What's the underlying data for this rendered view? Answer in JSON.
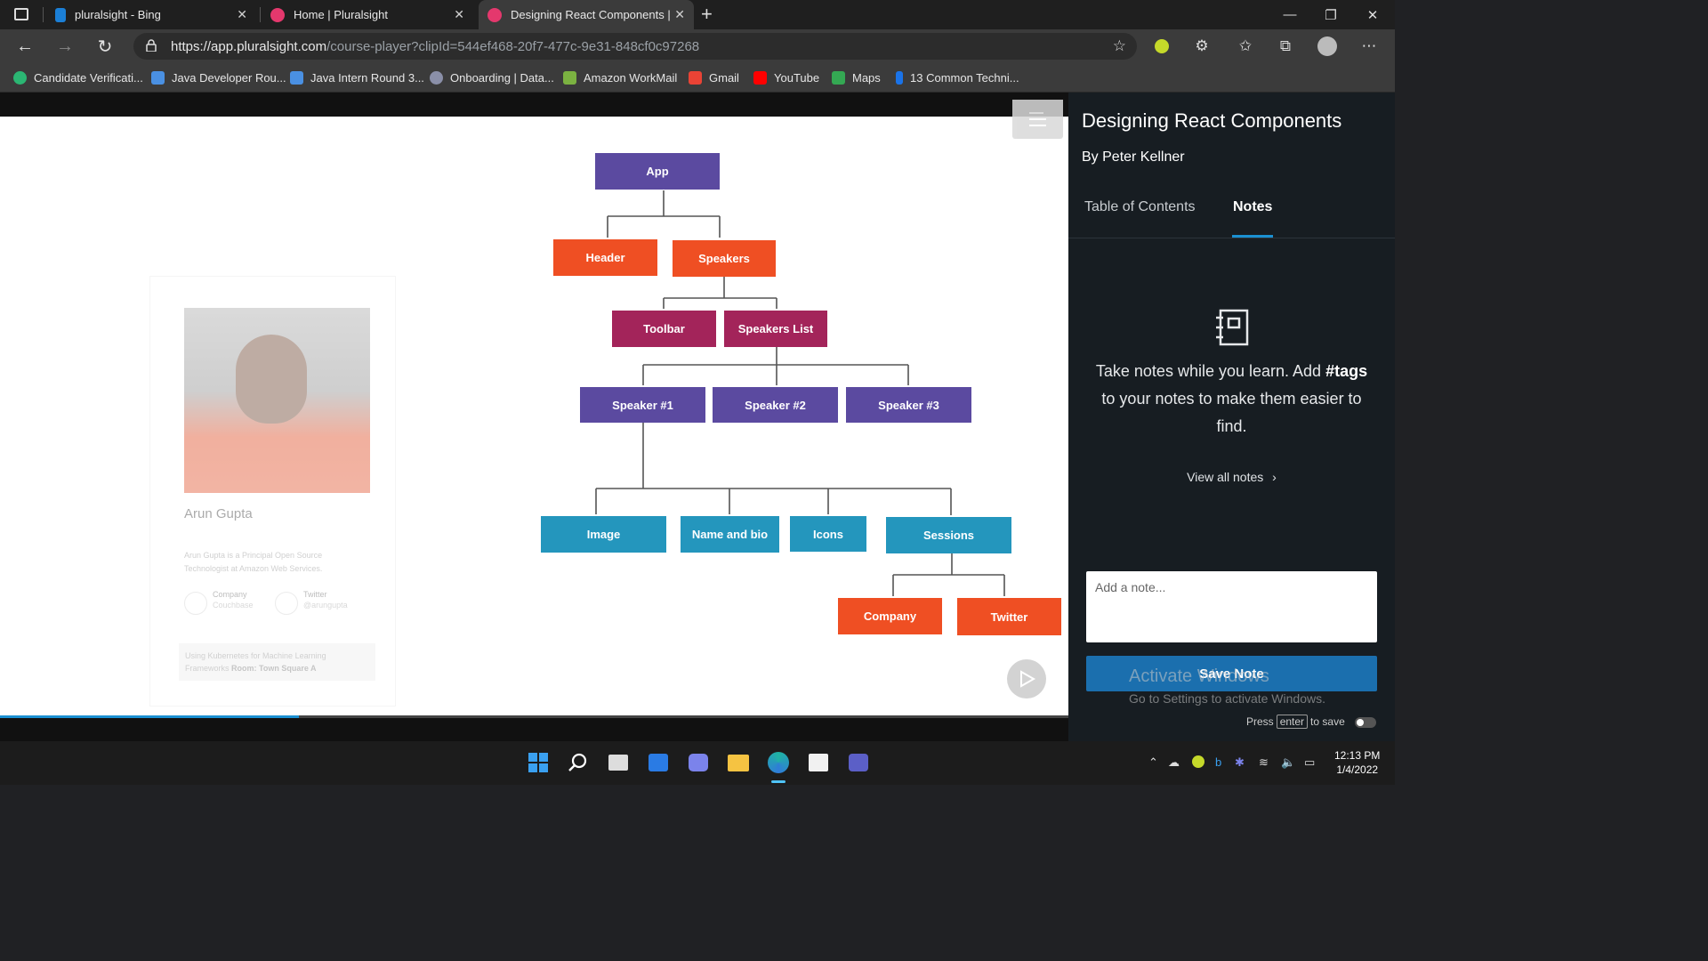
{
  "browser": {
    "tabs": [
      {
        "title": "pluralsight - Bing",
        "favicon": "bing-icon"
      },
      {
        "title": "Home | Pluralsight",
        "favicon": "pluralsight-icon"
      },
      {
        "title": "Designing React Components | P",
        "favicon": "pluralsight-icon",
        "active": true
      }
    ],
    "new_tab": "+",
    "url_host": "https://app.pluralsight.com",
    "url_path": "/course-player?clipId=544ef468-20f7-477c-9e31-848cf0c97268",
    "bookmarks": [
      {
        "label": "Candidate Verificati...",
        "icon": "check-circle-icon",
        "color": "#2bb673"
      },
      {
        "label": "Java Developer Rou...",
        "icon": "cube-icon",
        "color": "#4a90e2"
      },
      {
        "label": "Java Intern Round 3...",
        "icon": "cube-icon",
        "color": "#4a90e2"
      },
      {
        "label": "Onboarding | Data...",
        "icon": "rocket-icon",
        "color": "#8a8fa8"
      },
      {
        "label": "Amazon WorkMail",
        "icon": "mail-icon",
        "color": "#7bb241"
      },
      {
        "label": "Gmail",
        "icon": "gmail-icon",
        "color": "#ea4335"
      },
      {
        "label": "YouTube",
        "icon": "youtube-icon",
        "color": "#ff0000"
      },
      {
        "label": "Maps",
        "icon": "maps-icon",
        "color": "#34a853"
      },
      {
        "label": "13 Common Techni...",
        "icon": "info-icon",
        "color": "#1a73e8"
      }
    ]
  },
  "slide": {
    "card": {
      "name": "Arun Gupta",
      "bio": "Arun Gupta is a Principal Open Source Technologist at Amazon Web Services.",
      "company_label": "Company",
      "company_value": "Couchbase",
      "twitter_label": "Twitter",
      "twitter_value": "@arungupta",
      "session_text": "Using Kubernetes for Machine Learning Frameworks",
      "session_room_label": "Room: Town Square A"
    },
    "diagram": {
      "app": "App",
      "header": "Header",
      "speakers": "Speakers",
      "toolbar": "Toolbar",
      "speakers_list": "Speakers List",
      "speaker1": "Speaker #1",
      "speaker2": "Speaker #2",
      "speaker3": "Speaker #3",
      "image": "Image",
      "name_bio": "Name and bio",
      "icons": "Icons",
      "sessions": "Sessions",
      "company": "Company",
      "twitter": "Twitter"
    },
    "progress": 0.28
  },
  "sidebar": {
    "title": "Designing React Components",
    "author": "By Peter Kellner",
    "tabs": [
      "Table of Contents",
      "Notes"
    ],
    "active_tab": "Notes",
    "empty_line1": "Take notes while you learn. Add",
    "empty_tags": "#tags",
    "empty_line2": "to your notes to make them easier to find.",
    "view_all": "View all notes",
    "note_placeholder": "Add a note...",
    "save_label": "Save Note",
    "press_prefix": "Press",
    "press_key": "enter",
    "press_suffix": "to save"
  },
  "watermark": {
    "line1": "Activate Windows",
    "line2": "Go to Settings to activate Windows."
  },
  "taskbar": {
    "time": "12:13 PM",
    "date": "1/4/2022"
  }
}
